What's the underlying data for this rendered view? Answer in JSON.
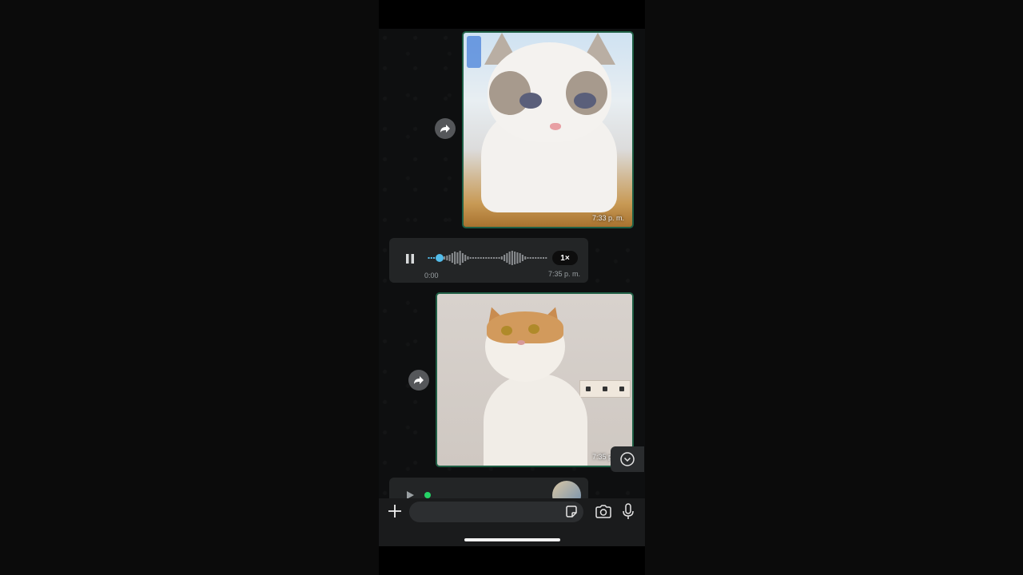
{
  "messages": {
    "image1": {
      "time": "7:33 p. m."
    },
    "voice": {
      "duration": "0:00",
      "time": "7:35 p. m.",
      "speed": "1×",
      "progress": 0.1
    },
    "image2": {
      "time": "7:35 p. m."
    }
  },
  "composer": {
    "placeholder": "",
    "value": ""
  },
  "colors": {
    "bubble_border": "#1f5f45",
    "accent": "#53bdeb",
    "wave": "#8a8d90"
  }
}
